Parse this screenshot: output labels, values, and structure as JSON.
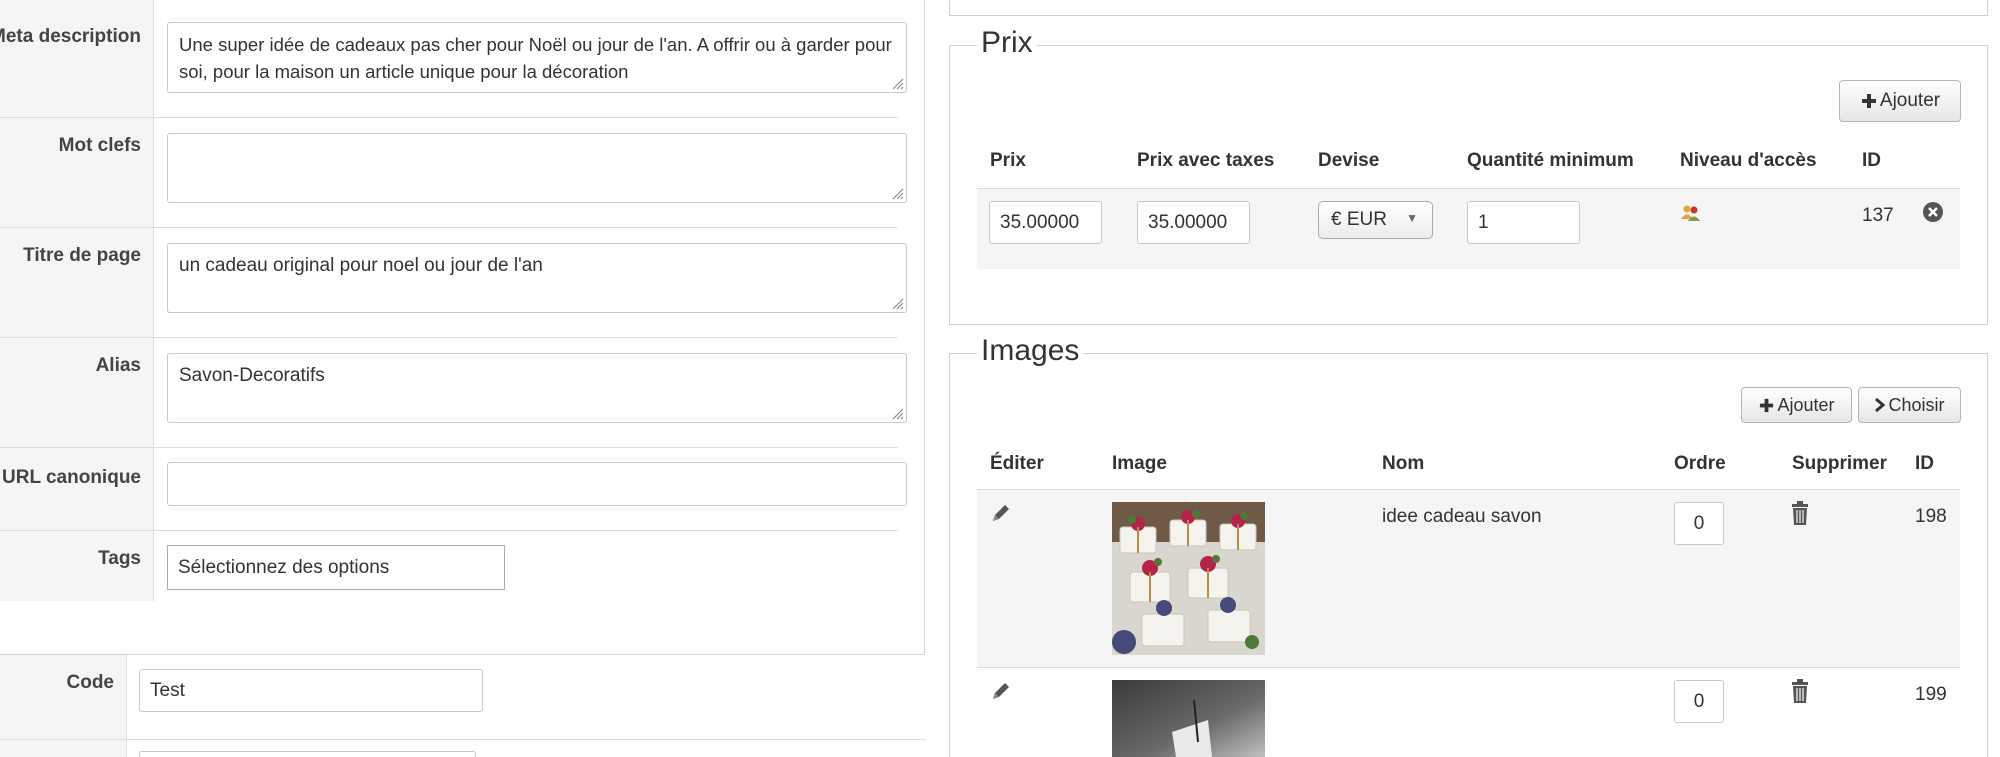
{
  "seo": {
    "meta_description": {
      "label": "Meta description",
      "value": "Une super idée de cadeaux pas cher pour Noël ou jour de l'an. A offrir ou à garder pour soi, pour la maison un article unique pour la décoration"
    },
    "keywords": {
      "label": "Mot clefs",
      "value": ""
    },
    "page_title": {
      "label": "Titre de page",
      "value": "un cadeau original pour noel ou jour de l'an"
    },
    "alias": {
      "label": "Alias",
      "value": "Savon-Decoratifs"
    },
    "canonical_url": {
      "label": "URL canonique",
      "value": ""
    },
    "tags": {
      "label": "Tags",
      "placeholder": "Sélectionnez des options"
    }
  },
  "general": {
    "code": {
      "label": "Code",
      "value": "Test"
    }
  },
  "prices": {
    "legend": "Prix",
    "add_label": "Ajouter",
    "headers": [
      "Prix",
      "Prix avec taxes",
      "Devise",
      "Quantité minimum",
      "Niveau d'accès",
      "ID"
    ],
    "rows": [
      {
        "price": "35.00000",
        "price_with_tax": "35.00000",
        "currency": "€ EUR",
        "min_qty": "1",
        "access_icon": "users-icon",
        "id": "137"
      }
    ]
  },
  "images": {
    "legend": "Images",
    "add_label": "Ajouter",
    "choose_label": "Choisir",
    "headers": [
      "Éditer",
      "Image",
      "Nom",
      "Ordre",
      "Supprimer",
      "ID"
    ],
    "rows": [
      {
        "name": "idee cadeau savon",
        "order": "0",
        "id": "198"
      },
      {
        "name": "",
        "order": "0",
        "id": "199"
      }
    ]
  },
  "colors": {
    "label_bg": "#f5f5f5",
    "border": "#c8c8c8",
    "accent_orange": "#e8a23a"
  }
}
